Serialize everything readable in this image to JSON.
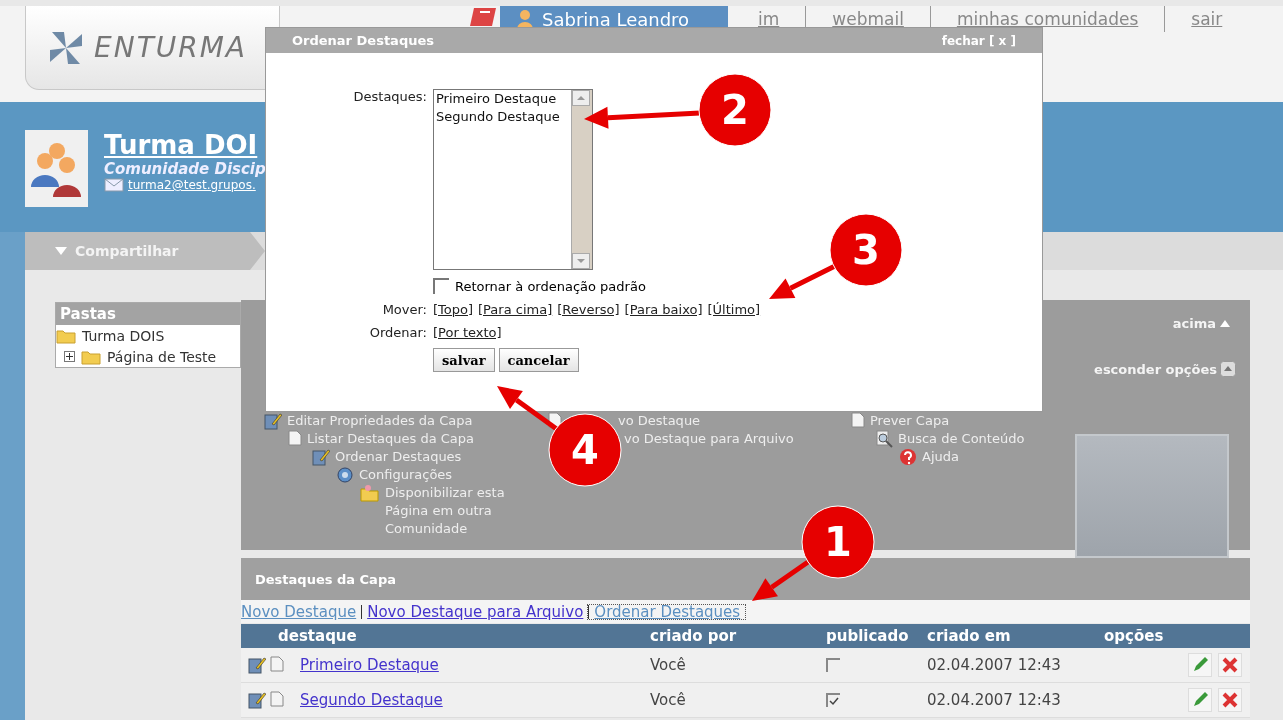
{
  "header": {
    "logo": "ENTURMA",
    "user": "Sabrina Leandro",
    "links": [
      "im",
      "webmail",
      "minhas comunidades",
      "sair"
    ]
  },
  "community": {
    "title": "Turma DOI",
    "subtitle": "Comunidade Discip",
    "email": "turma2@test.grupos."
  },
  "share_tab": {
    "label": "Compartilhar"
  },
  "folders": {
    "title": "Pastas",
    "tree": [
      {
        "label": "Turma DOIS",
        "children": [
          {
            "label": "Página de Teste",
            "expanded": false
          }
        ]
      }
    ]
  },
  "options_panel": {
    "top_link": "acima",
    "toggle": "esconder opções",
    "columns": [
      [
        "Editar Propriedades da Capa",
        "Listar Destaques da Capa",
        "Ordenar Destaques",
        "Configurações",
        "Disponibilizar esta Página em outra Comunidade"
      ],
      [
        "vo Destaque",
        "vo Destaque para Arquivo"
      ],
      [
        "Prever Capa",
        "Busca de Conteúdo",
        "Ajuda"
      ]
    ]
  },
  "dialog": {
    "title": "Ordenar Destaques",
    "close": "fechar [ x ]",
    "list_label": "Destaques:",
    "list_items": [
      {
        "label": "Primeiro Destaque",
        "selected": false
      },
      {
        "label": "Segundo Destaque",
        "selected": false
      }
    ],
    "reset": {
      "label": "Retornar à ordenação padrão",
      "checked": false
    },
    "move_label": "Mover:",
    "move_links": [
      "[Topo]",
      "[Para cima]",
      "[Reverso]",
      "[Para baixo]",
      "[Último]"
    ],
    "sort_label": "Ordenar:",
    "sort_links": [
      "[Por texto]"
    ],
    "buttons": [
      "salvar",
      "cancelar"
    ]
  },
  "highlights": {
    "title": "Destaques da Capa",
    "links": [
      {
        "label": "Novo Destaque",
        "visited": true,
        "focused": false
      },
      {
        "label": "Novo Destaque para Arquivo",
        "visited": false,
        "focused": false
      },
      {
        "label": "Ordenar Destaques",
        "visited": true,
        "focused": true
      }
    ]
  },
  "table": {
    "columns": [
      "destaque",
      "criado por",
      "publicado",
      "criado em",
      "opções"
    ],
    "rows": [
      {
        "title": "Primeiro Destaque",
        "author": "Você",
        "published": false,
        "created": "02.04.2007 12:43"
      },
      {
        "title": "Segundo Destaque",
        "author": "Você",
        "published": true,
        "created": "02.04.2007 12:43"
      }
    ]
  },
  "annotations": [
    {
      "label": "2"
    },
    {
      "label": "3"
    },
    {
      "label": "4"
    },
    {
      "label": "1"
    }
  ]
}
